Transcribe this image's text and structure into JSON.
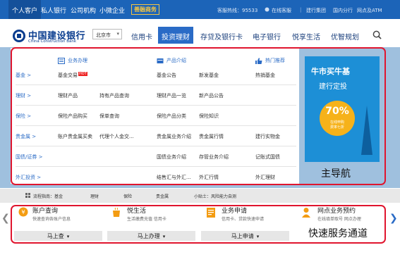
{
  "topbar": {
    "tabs": [
      "个人客户",
      "私人银行",
      "公司机构",
      "小微企业"
    ],
    "finance_badge": "善融商务",
    "hotline": "客服热线：95533",
    "links": [
      "在线客服",
      "建行集团",
      "国内分行",
      "网点及ATM"
    ]
  },
  "header": {
    "logo_cn": "中国建设银行",
    "logo_en": "China Construction Bank",
    "city": "北京市",
    "nav": [
      "信用卡",
      "投资理财",
      "存贷及银行卡",
      "电子银行",
      "悦享生活",
      "优智规划"
    ],
    "active_nav": "投资理财"
  },
  "menu": {
    "columns": [
      {
        "title": "业务办理",
        "icon": "form-icon"
      },
      {
        "title": "产品介绍",
        "icon": "card-icon"
      },
      {
        "title": "热门推荐",
        "icon": "thumb-up-icon"
      }
    ],
    "rows": [
      {
        "label": "基金 >",
        "cells": [
          "基金交易",
          "基金公告",
          "新发基金",
          "热销基金"
        ],
        "hot": "HOT"
      },
      {
        "label": "理财 >",
        "cells": [
          "理财产品",
          "持有产品查询",
          "理财产品一览",
          "新产品公告"
        ]
      },
      {
        "label": "保险 >",
        "cells": [
          "保险产品购买",
          "保单查询",
          "保险产品分类",
          "保险知识"
        ]
      },
      {
        "label": "贵金属 >",
        "cells": [
          "账户贵金属买卖",
          "代理个人金交...",
          "贵金属业务介绍",
          "贵金属行情",
          "建行实物金"
        ]
      },
      {
        "label": "国债/证券 >",
        "cells": [
          "国债业务介绍",
          "存管业务介绍",
          "记账式国债"
        ]
      },
      {
        "label": "外汇投资 >",
        "cells": [
          "结售汇与外汇...",
          "外汇行情",
          "外汇理财"
        ]
      }
    ]
  },
  "ad": {
    "line1": "牛市买牛基",
    "line2": "建行定投",
    "percent": "70%",
    "sub1": "在线申购",
    "sub2": "费率七折"
  },
  "main_nav_label": "主导航",
  "process": {
    "title": "流程指南：基金",
    "items": [
      "理财",
      "保险",
      "贵金属",
      "小贴士：风险能力自测"
    ]
  },
  "quick_services": [
    {
      "title": "账户查询",
      "sub": "快速查询各账户信息",
      "button": "马上查",
      "icon": "yen-coin-icon"
    },
    {
      "title": "悦生活",
      "sub": "生活缴费充值 信用卡",
      "button": "马上办理",
      "icon": "cup-icon"
    },
    {
      "title": "业务申请",
      "sub": "信用卡、贷款快速申请",
      "button": "马上申请",
      "icon": "document-icon"
    },
    {
      "title": "网点业务预约",
      "sub": "在线填单取号 网点办理",
      "button": "",
      "icon": "person-icon"
    }
  ],
  "quick_label": "快速服务通道",
  "colors": {
    "brand": "#1c64b8",
    "active_nav": "#2a6bc6",
    "highlight": "#e0152e",
    "ad_bg": "#1d8fd6"
  }
}
